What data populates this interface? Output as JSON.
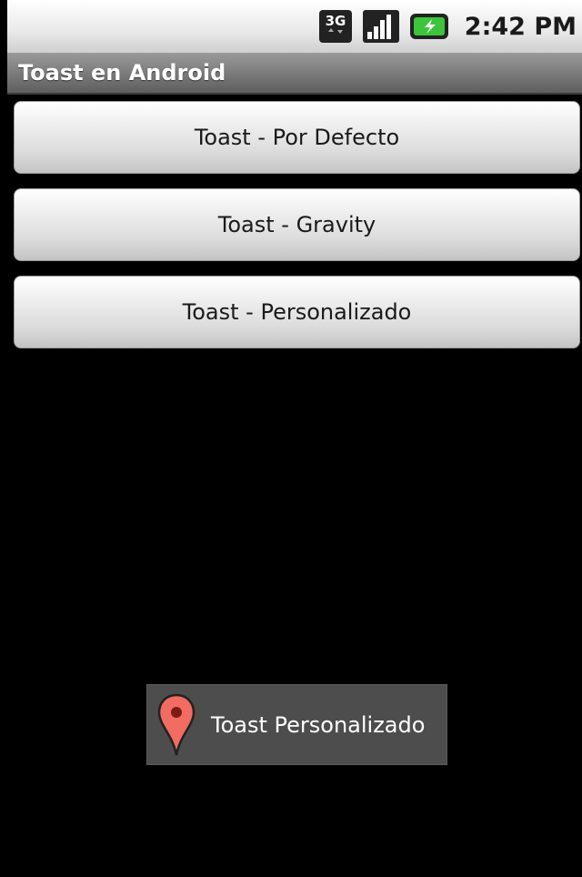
{
  "status_bar": {
    "network_label": "3G",
    "signal_icon": "signal-bars-icon",
    "battery_icon": "battery-charging-icon",
    "time": "2:42 PM"
  },
  "title_bar": {
    "title": "Toast en Android"
  },
  "buttons": [
    {
      "label": "Toast - Por Defecto"
    },
    {
      "label": "Toast - Gravity"
    },
    {
      "label": "Toast - Personalizado"
    }
  ],
  "toast": {
    "icon": "map-pin-icon",
    "text": "Toast Personalizado"
  },
  "colors": {
    "background": "#000000",
    "toast_background": "#4d4d4d",
    "pin_red": "#f36c61",
    "battery_green": "#3cc43c"
  }
}
